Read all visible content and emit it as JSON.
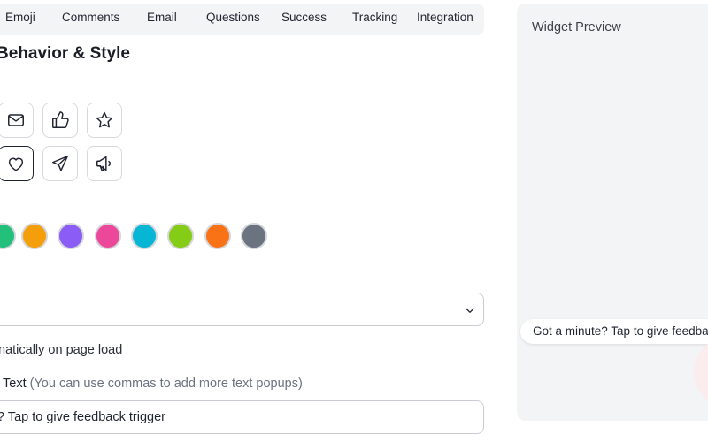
{
  "tabs": [
    {
      "label": "Emoji"
    },
    {
      "label": "Comments"
    },
    {
      "label": "Email"
    },
    {
      "label": "Questions"
    },
    {
      "label": "Success"
    },
    {
      "label": "Tracking"
    },
    {
      "label": "Integration"
    }
  ],
  "section": {
    "title": "Behavior & Style"
  },
  "icons": [
    {
      "name": "mail-icon",
      "selected": false
    },
    {
      "name": "thumbs-up-icon",
      "selected": false
    },
    {
      "name": "star-icon",
      "selected": false
    },
    {
      "name": "heart-icon",
      "selected": true
    },
    {
      "name": "send-icon",
      "selected": false
    },
    {
      "name": "megaphone-icon",
      "selected": false
    }
  ],
  "colors": [
    "#22c07a",
    "#f59e0b",
    "#8b5cf6",
    "#ec4899",
    "#06b6d4",
    "#84cc16",
    "#f97316",
    "#6b7280"
  ],
  "trigger_select": {
    "value": ":"
  },
  "auto_open": {
    "text": "natically on page load"
  },
  "popup_text": {
    "label": "Text",
    "hint": "(You can use commas to add more text popups)",
    "value": "? Tap to give feedback trigger"
  },
  "preview": {
    "title": "Widget Preview",
    "popup": "Got a minute? Tap to give feedback"
  }
}
